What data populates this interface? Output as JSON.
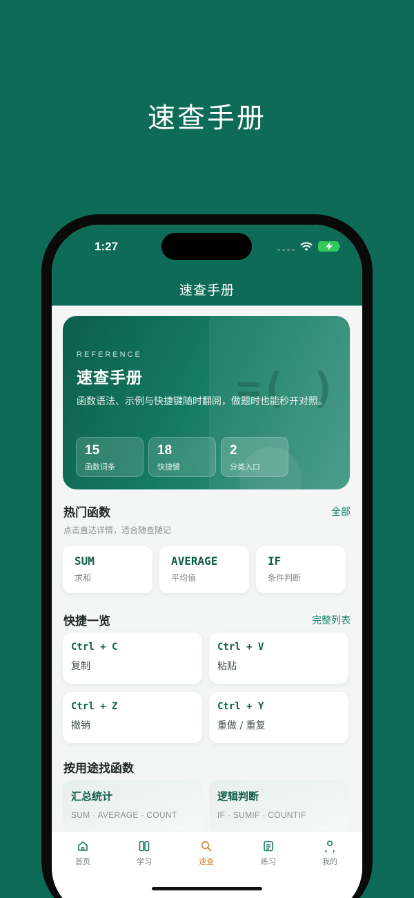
{
  "headline": "速查手册",
  "status": {
    "time": "1:27"
  },
  "nav": {
    "title": "速查手册"
  },
  "hero": {
    "kicker": "REFERENCE",
    "title": "速查手册",
    "description": "函数语法、示例与快捷键随时翻阅，做题时也能秒开对照。",
    "decoration": "=( )",
    "stats": [
      {
        "value": "15",
        "label": "函数词条"
      },
      {
        "value": "18",
        "label": "快捷键"
      },
      {
        "value": "2",
        "label": "分类入口"
      }
    ]
  },
  "popular": {
    "title": "热门函数",
    "link": "全部",
    "subtitle": "点击直达详情，适合随查随记",
    "items": [
      {
        "name": "SUM",
        "desc": "求和"
      },
      {
        "name": "AVERAGE",
        "desc": "平均值"
      },
      {
        "name": "IF",
        "desc": "条件判断"
      }
    ]
  },
  "shortcuts": {
    "title": "快捷一览",
    "link": "完整列表",
    "items": [
      {
        "keys": "Ctrl + C",
        "label": "复制"
      },
      {
        "keys": "Ctrl + V",
        "label": "粘贴"
      },
      {
        "keys": "Ctrl + Z",
        "label": "撤销"
      },
      {
        "keys": "Ctrl + Y",
        "label": "重做 / 重复"
      }
    ]
  },
  "byUse": {
    "title": "按用途找函数",
    "items": [
      {
        "title": "汇总统计",
        "desc": "SUM · AVERAGE · COUNT"
      },
      {
        "title": "逻辑判断",
        "desc": "IF · SUMIF · COUNTIF"
      }
    ]
  },
  "tabs": [
    {
      "label": "首页",
      "icon": "home-icon"
    },
    {
      "label": "学习",
      "icon": "book-icon"
    },
    {
      "label": "速查",
      "icon": "search-icon",
      "active": true
    },
    {
      "label": "练习",
      "icon": "list-icon"
    },
    {
      "label": "我的",
      "icon": "user-icon"
    }
  ],
  "colors": {
    "brand": "#0e6b57",
    "accent": "#c98a33",
    "link": "#16856a"
  }
}
